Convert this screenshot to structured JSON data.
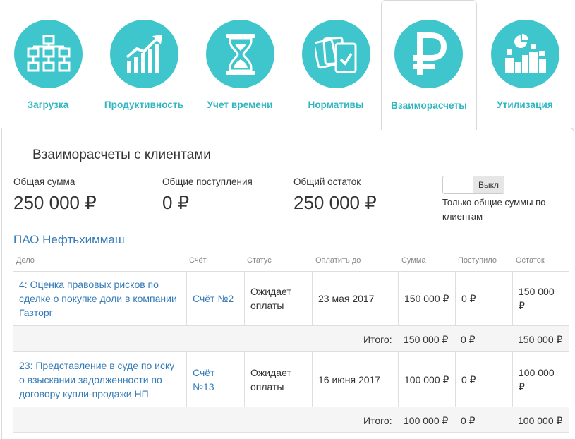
{
  "tabs": [
    {
      "label": "Загрузка",
      "icon": "hierarchy-icon"
    },
    {
      "label": "Продуктивность",
      "icon": "growth-chart-icon"
    },
    {
      "label": "Учет времени",
      "icon": "hourglass-icon"
    },
    {
      "label": "Нормативы",
      "icon": "cards-check-icon"
    },
    {
      "label": "Взаиморасчеты",
      "icon": "ruble-icon",
      "active": true
    },
    {
      "label": "Утилизация",
      "icon": "utilization-icon"
    }
  ],
  "accent_color": "#3ec6cc",
  "link_color": "#337ab7",
  "panel": {
    "title": "Взаиморасчеты с клиентами",
    "totals": [
      {
        "label": "Общая сумма",
        "value": "250 000 ₽"
      },
      {
        "label": "Общие поступления",
        "value": "0 ₽"
      },
      {
        "label": "Общий остаток",
        "value": "250 000 ₽"
      }
    ],
    "toggle": {
      "state_label": "Выкл",
      "caption": "Только общие суммы по клиентам"
    }
  },
  "client": {
    "name": "ПАО Нефтьхиммаш",
    "columns": [
      "Дело",
      "Счёт",
      "Статус",
      "Оплатить до",
      "Сумма",
      "Поступило",
      "Остаток"
    ],
    "rows": [
      {
        "case": "4: Оценка правовых рисков по сделке о покупке доли в компании Газторг",
        "invoice": "Счёт №2",
        "status": "Ожидает оплаты",
        "due": "23 мая 2017",
        "amount": "150 000 ₽",
        "received": "0 ₽",
        "balance": "150 000 ₽",
        "total_label": "Итого:",
        "total_amount": "150 000 ₽",
        "total_received": "0 ₽",
        "total_balance": "150 000 ₽"
      },
      {
        "case": "23: Представление в суде по иску о взыскании задолженности по договору купли-продажи НП",
        "invoice": "Счёт №13",
        "status": "Ожидает оплаты",
        "due": "16 июня 2017",
        "amount": "100 000 ₽",
        "received": "0 ₽",
        "balance": "100 000 ₽",
        "total_label": "Итого:",
        "total_amount": "100 000 ₽",
        "total_received": "0 ₽",
        "total_balance": "100 000 ₽"
      }
    ]
  }
}
